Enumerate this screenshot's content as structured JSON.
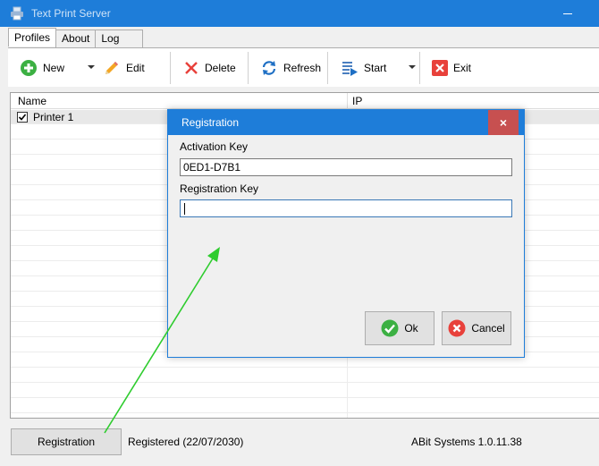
{
  "window": {
    "title": "Text Print Server"
  },
  "tabs": [
    {
      "label": "Profiles",
      "active": true
    },
    {
      "label": "About",
      "active": false
    },
    {
      "label": "Log",
      "active": false
    }
  ],
  "toolbar": {
    "new_label": "New",
    "edit_label": "Edit",
    "delete_label": "Delete",
    "refresh_label": "Refresh",
    "start_label": "Start",
    "exit_label": "Exit"
  },
  "grid": {
    "columns": [
      "Name",
      "IP"
    ],
    "rows": [
      {
        "name": "Printer 1",
        "checked": true
      }
    ]
  },
  "status_bar": {
    "registration_button": "Registration",
    "registered_text": "Registered (22/07/2030)",
    "version_text": "ABit Systems 1.0.11.38"
  },
  "dialog": {
    "title": "Registration",
    "close_glyph": "×",
    "activation_key_label": "Activation Key",
    "activation_key_value": "0ED1-D7B1",
    "registration_key_label": "Registration Key",
    "registration_key_value": "",
    "ok_label": "Ok",
    "cancel_label": "Cancel"
  },
  "colors": {
    "titlebar": "#1e7dd9",
    "close_button": "#c75050",
    "annotation_arrow": "#2ecc2e",
    "ok_green": "#3cb043",
    "cancel_red": "#e8413b"
  }
}
